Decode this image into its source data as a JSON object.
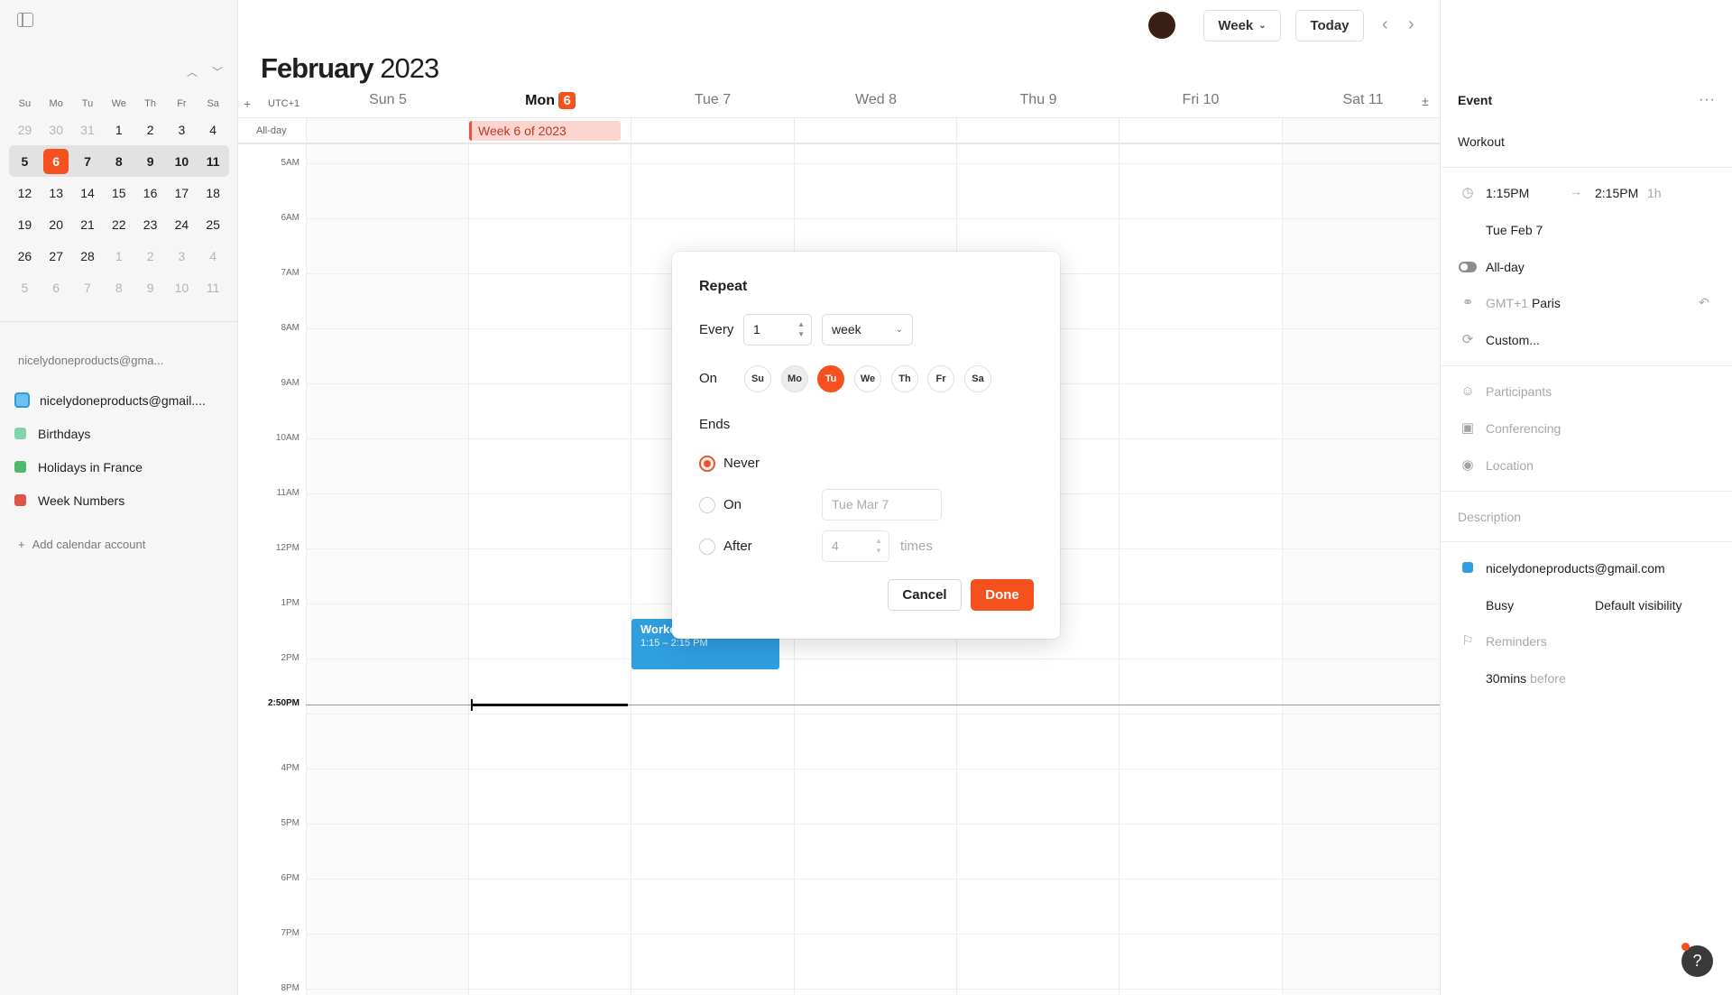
{
  "topbar": {
    "view": "Week",
    "today_label": "Today"
  },
  "header": {
    "month": "February",
    "year": "2023",
    "timezone": "UTC+1",
    "allday_label": "All-day",
    "days": [
      {
        "name": "Sun",
        "num": "5"
      },
      {
        "name": "Mon",
        "num": "6"
      },
      {
        "name": "Tue",
        "num": "7"
      },
      {
        "name": "Wed",
        "num": "8"
      },
      {
        "name": "Thu",
        "num": "9"
      },
      {
        "name": "Fri",
        "num": "10"
      },
      {
        "name": "Sat",
        "num": "11"
      }
    ]
  },
  "mini_calendar": {
    "weekdays": [
      "Su",
      "Mo",
      "Tu",
      "We",
      "Th",
      "Fr",
      "Sa"
    ],
    "weeks": [
      [
        "29",
        "30",
        "31",
        "1",
        "2",
        "3",
        "4"
      ],
      [
        "5",
        "6",
        "7",
        "8",
        "9",
        "10",
        "11"
      ],
      [
        "12",
        "13",
        "14",
        "15",
        "16",
        "17",
        "18"
      ],
      [
        "19",
        "20",
        "21",
        "22",
        "23",
        "24",
        "25"
      ],
      [
        "26",
        "27",
        "28",
        "1",
        "2",
        "3",
        "4"
      ],
      [
        "5",
        "6",
        "7",
        "8",
        "9",
        "10",
        "11"
      ]
    ]
  },
  "sidebar": {
    "account_email": "nicelydoneproducts@gma...",
    "calendars": [
      {
        "label": "nicelydoneproducts@gmail....",
        "color": "#2e9bdc"
      },
      {
        "label": "Birthdays",
        "color": "#7fd4a8"
      },
      {
        "label": "Holidays in France",
        "color": "#4cbb6c"
      },
      {
        "label": "Week Numbers",
        "color": "#e0554a"
      }
    ],
    "add_account": "Add calendar account"
  },
  "grid": {
    "hours": [
      "5AM",
      "6AM",
      "7AM",
      "8AM",
      "9AM",
      "10AM",
      "11AM",
      "12PM",
      "1PM",
      "2PM",
      "",
      "4PM",
      "5PM",
      "6PM",
      "7PM",
      "8PM"
    ],
    "now_label": "2:50PM",
    "week_chip": "Week 6 of 2023",
    "event": {
      "title": "Workout",
      "time": "1:15 – 2:15 PM"
    }
  },
  "panel": {
    "heading": "Event",
    "title": "Workout",
    "start": "1:15PM",
    "end": "2:15PM",
    "duration": "1h",
    "date": "Tue Feb 7",
    "allday": "All-day",
    "tz_offset": "GMT+1",
    "tz_city": "Paris",
    "repeat": "Custom...",
    "participants": "Participants",
    "conferencing": "Conferencing",
    "location": "Location",
    "description": "Description",
    "calendar_email": "nicelydoneproducts@gmail.com",
    "busy": "Busy",
    "visibility": "Default visibility",
    "reminders": "Reminders",
    "reminder_value": "30mins",
    "reminder_suffix": "before"
  },
  "modal": {
    "title": "Repeat",
    "every_label": "Every",
    "every_value": "1",
    "unit": "week",
    "on_label": "On",
    "days": [
      "Su",
      "Mo",
      "Tu",
      "We",
      "Th",
      "Fr",
      "Sa"
    ],
    "ends_label": "Ends",
    "never": "Never",
    "on": "On",
    "on_date_placeholder": "Tue Mar 7",
    "after": "After",
    "after_count": "4",
    "times": "times",
    "cancel": "Cancel",
    "done": "Done"
  },
  "help": "?",
  "colors": {
    "accent": "#f4511e",
    "event_blue": "#2f9fe0",
    "week_chip": "#fbd5d0"
  }
}
